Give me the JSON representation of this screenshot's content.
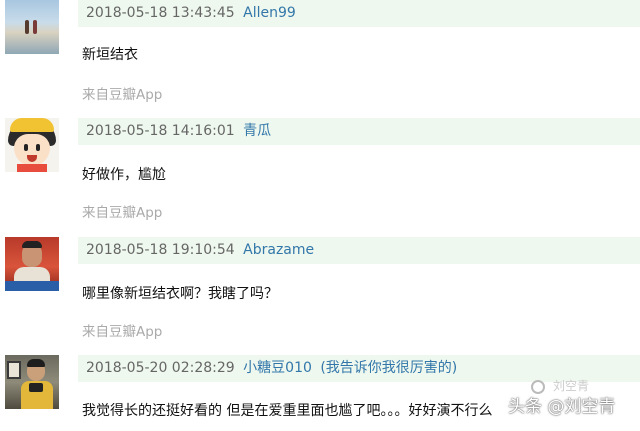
{
  "comments": [
    {
      "avatar": "beach-photo-avatar",
      "time": "2018-05-18 13:43:45",
      "user": "Allen99",
      "signature": "",
      "text": "新垣结衣",
      "source": "来自豆瓣App"
    },
    {
      "avatar": "maruko-cartoon-avatar",
      "time": "2018-05-18 14:16:01",
      "user": "青瓜",
      "signature": "",
      "text": "好做作，尴尬",
      "source": "来自豆瓣App"
    },
    {
      "avatar": "man-red-background-avatar",
      "time": "2018-05-18 19:10:54",
      "user": "Abrazame",
      "signature": "",
      "text": "哪里像新垣结衣啊？我瞎了吗？",
      "source": "来自豆瓣App"
    },
    {
      "avatar": "person-with-camera-avatar",
      "time": "2018-05-20 02:28:29",
      "user": "小糖豆010",
      "signature": "(我告诉你我很厉害的)",
      "text": "我觉得长的还挺好看的 但是在爱重里面也尴了吧。。。好好演不行么",
      "source": ""
    }
  ],
  "watermark": {
    "main": "头条 @刘空青",
    "small": "刘空青"
  },
  "colors": {
    "meta_bar_bg": "#eef8ee",
    "username_link": "#3377aa",
    "source_text": "#aaaaaa"
  }
}
